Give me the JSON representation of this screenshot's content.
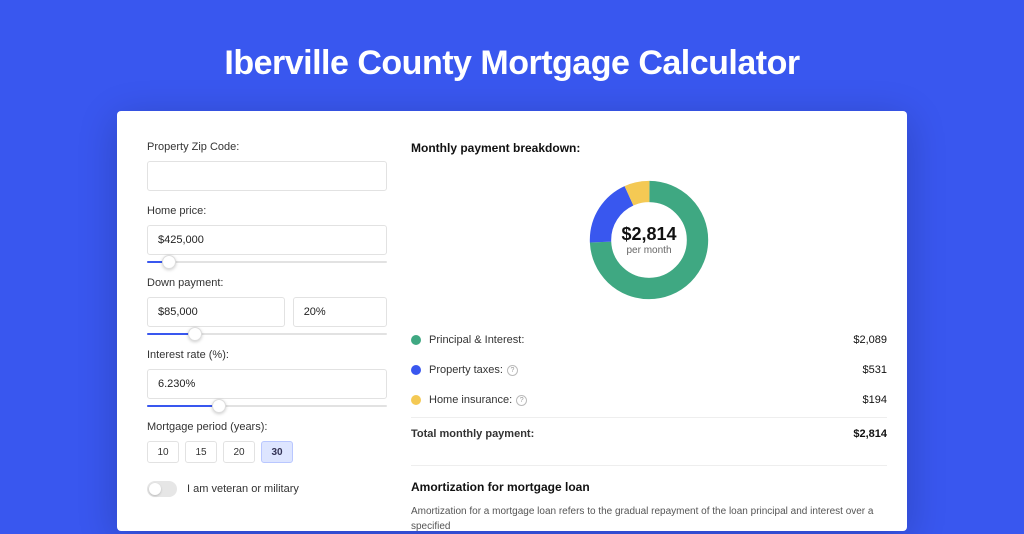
{
  "title": "Iberville County Mortgage Calculator",
  "left": {
    "zip_label": "Property Zip Code:",
    "zip_value": "",
    "home_price_label": "Home price:",
    "home_price_value": "$425,000",
    "home_price_slider_pct": 9,
    "down_payment_label": "Down payment:",
    "down_payment_value": "$85,000",
    "down_payment_pct_value": "20%",
    "down_payment_slider_pct": 20,
    "interest_label": "Interest rate (%):",
    "interest_value": "6.230%",
    "interest_slider_pct": 30,
    "period_label": "Mortgage period (years):",
    "periods": [
      "10",
      "15",
      "20",
      "30"
    ],
    "period_active_index": 3,
    "veteran_label": "I am veteran or military",
    "veteran_on": false
  },
  "right": {
    "breakdown_title": "Monthly payment breakdown:",
    "donut_amount": "$2,814",
    "donut_sub": "per month",
    "legend": [
      {
        "label": "Principal & Interest:",
        "value": "$2,089",
        "color": "#3fa882",
        "info": false
      },
      {
        "label": "Property taxes:",
        "value": "$531",
        "color": "#3957ef",
        "info": true
      },
      {
        "label": "Home insurance:",
        "value": "$194",
        "color": "#f4c954",
        "info": true
      }
    ],
    "total_label": "Total monthly payment:",
    "total_value": "$2,814",
    "amort_title": "Amortization for mortgage loan",
    "amort_body": "Amortization for a mortgage loan refers to the gradual repayment of the loan principal and interest over a specified"
  },
  "chart_data": {
    "type": "pie",
    "title": "Monthly payment breakdown",
    "series": [
      {
        "name": "Principal & Interest",
        "value": 2089,
        "color": "#3fa882"
      },
      {
        "name": "Property taxes",
        "value": 531,
        "color": "#3957ef"
      },
      {
        "name": "Home insurance",
        "value": 194,
        "color": "#f4c954"
      }
    ],
    "total": 2814,
    "center_label": "$2,814 per month"
  }
}
